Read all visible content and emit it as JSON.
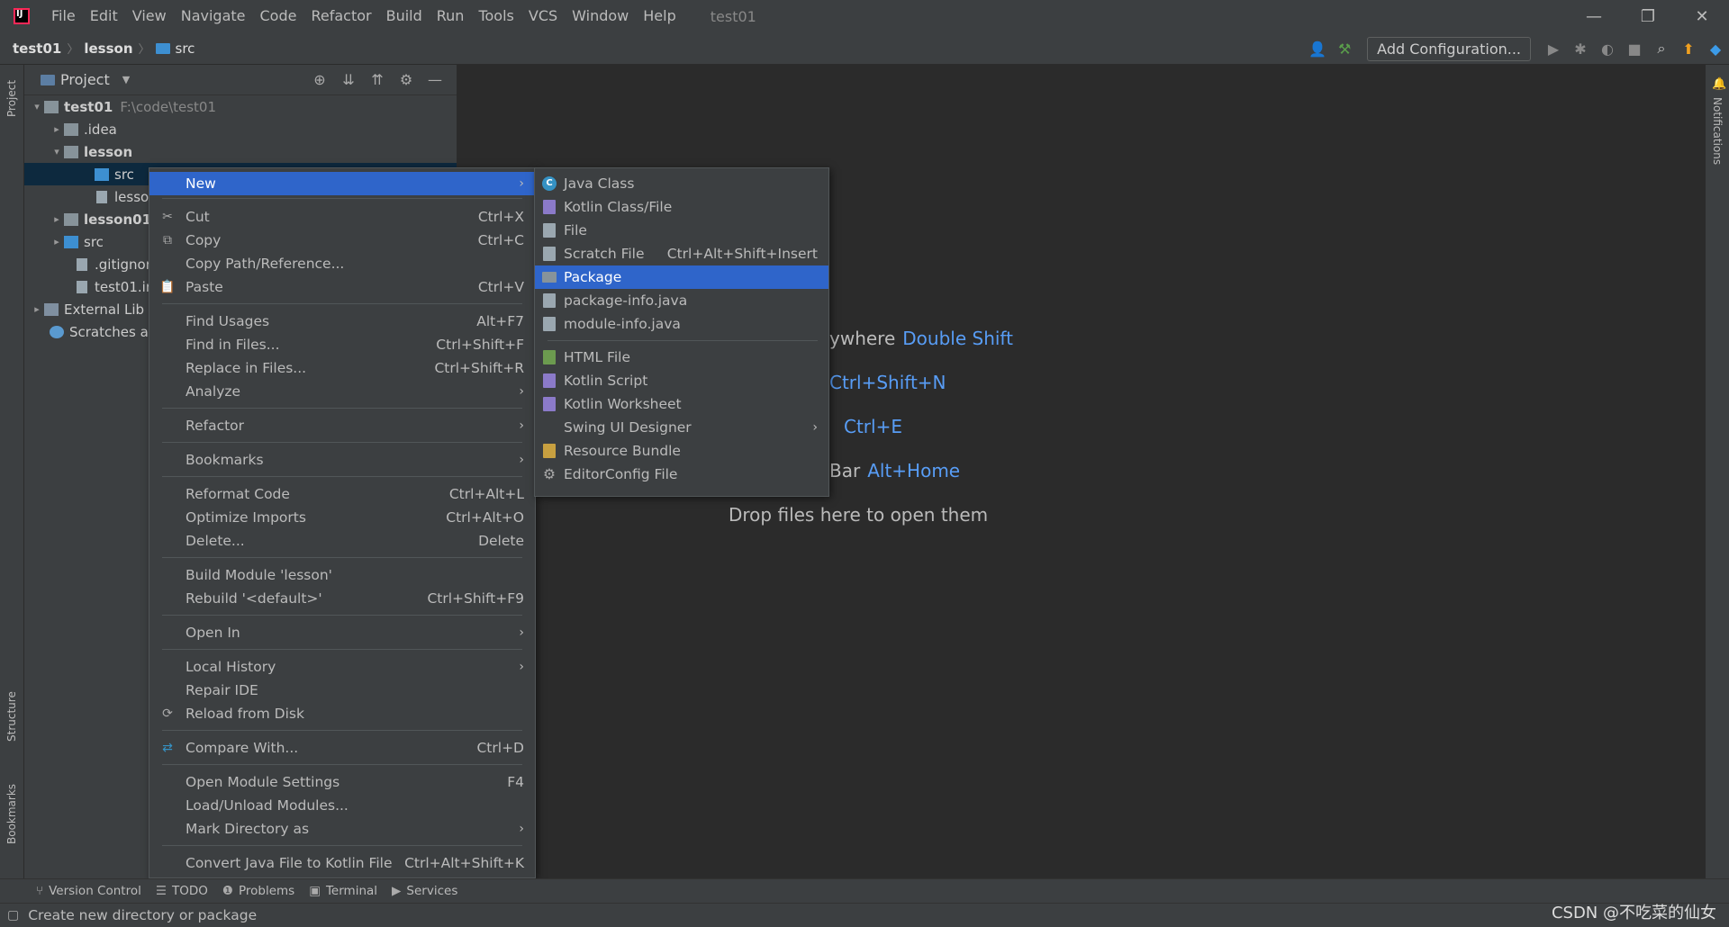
{
  "menubar": [
    "File",
    "Edit",
    "View",
    "Navigate",
    "Code",
    "Refactor",
    "Build",
    "Run",
    "Tools",
    "VCS",
    "Window",
    "Help"
  ],
  "window_title": "test01",
  "breadcrumb": {
    "root": "test01",
    "module": "lesson",
    "folder": "src"
  },
  "toolbar": {
    "add_configuration": "Add Configuration..."
  },
  "left_strip": {
    "project": "Project",
    "structure": "Structure",
    "bookmarks": "Bookmarks"
  },
  "right_strip": {
    "notifications": "Notifications"
  },
  "project_panel": {
    "title": "Project"
  },
  "tree": [
    {
      "label": "test01",
      "path": "F:\\code\\test01"
    },
    {
      "label": ".idea"
    },
    {
      "label": "lesson"
    },
    {
      "label": "src"
    },
    {
      "label": "lessor"
    },
    {
      "label": "lesson01"
    },
    {
      "label": "src"
    },
    {
      "label": ".gitignor"
    },
    {
      "label": "test01.in"
    },
    {
      "label": "External Lib"
    },
    {
      "label": "Scratches ar"
    }
  ],
  "editor_hints": {
    "l1": "ywhere",
    "l1k": "Double Shift",
    "l2k": "Ctrl+Shift+N",
    "l3k": "Ctrl+E",
    "l4": "Bar",
    "l4k": "Alt+Home",
    "drop": "Drop files here to open them"
  },
  "context_menu": [
    {
      "label": "New"
    },
    {
      "label": "Cut",
      "shortcut": "Ctrl+X"
    },
    {
      "label": "Copy",
      "shortcut": "Ctrl+C"
    },
    {
      "label": "Copy Path/Reference..."
    },
    {
      "label": "Paste",
      "shortcut": "Ctrl+V"
    },
    {
      "label": "Find Usages",
      "shortcut": "Alt+F7"
    },
    {
      "label": "Find in Files...",
      "shortcut": "Ctrl+Shift+F"
    },
    {
      "label": "Replace in Files...",
      "shortcut": "Ctrl+Shift+R"
    },
    {
      "label": "Analyze"
    },
    {
      "label": "Refactor"
    },
    {
      "label": "Bookmarks"
    },
    {
      "label": "Reformat Code",
      "shortcut": "Ctrl+Alt+L"
    },
    {
      "label": "Optimize Imports",
      "shortcut": "Ctrl+Alt+O"
    },
    {
      "label": "Delete...",
      "shortcut": "Delete"
    },
    {
      "label": "Build Module 'lesson'"
    },
    {
      "label": "Rebuild '<default>'",
      "shortcut": "Ctrl+Shift+F9"
    },
    {
      "label": "Open In"
    },
    {
      "label": "Local History"
    },
    {
      "label": "Repair IDE"
    },
    {
      "label": "Reload from Disk"
    },
    {
      "label": "Compare With...",
      "shortcut": "Ctrl+D"
    },
    {
      "label": "Open Module Settings",
      "shortcut": "F4"
    },
    {
      "label": "Load/Unload Modules..."
    },
    {
      "label": "Mark Directory as"
    },
    {
      "label": "Convert Java File to Kotlin File",
      "shortcut": "Ctrl+Alt+Shift+K"
    }
  ],
  "new_submenu": [
    {
      "label": "Java Class"
    },
    {
      "label": "Kotlin Class/File"
    },
    {
      "label": "File"
    },
    {
      "label": "Scratch File",
      "shortcut": "Ctrl+Alt+Shift+Insert"
    },
    {
      "label": "Package"
    },
    {
      "label": "package-info.java"
    },
    {
      "label": "module-info.java"
    },
    {
      "label": "HTML File"
    },
    {
      "label": "Kotlin Script"
    },
    {
      "label": "Kotlin Worksheet"
    },
    {
      "label": "Swing UI Designer"
    },
    {
      "label": "Resource Bundle"
    },
    {
      "label": "EditorConfig File"
    }
  ],
  "bottom_tools": [
    "Version Control",
    "TODO",
    "Problems",
    "Terminal",
    "Services"
  ],
  "status": "Create new directory or package",
  "watermark": "CSDN @不吃菜的仙女",
  "colors": {
    "highlight": "#2f65ca",
    "link": "#589df6",
    "background": "#2b2b2b",
    "panel": "#3c3f41"
  }
}
